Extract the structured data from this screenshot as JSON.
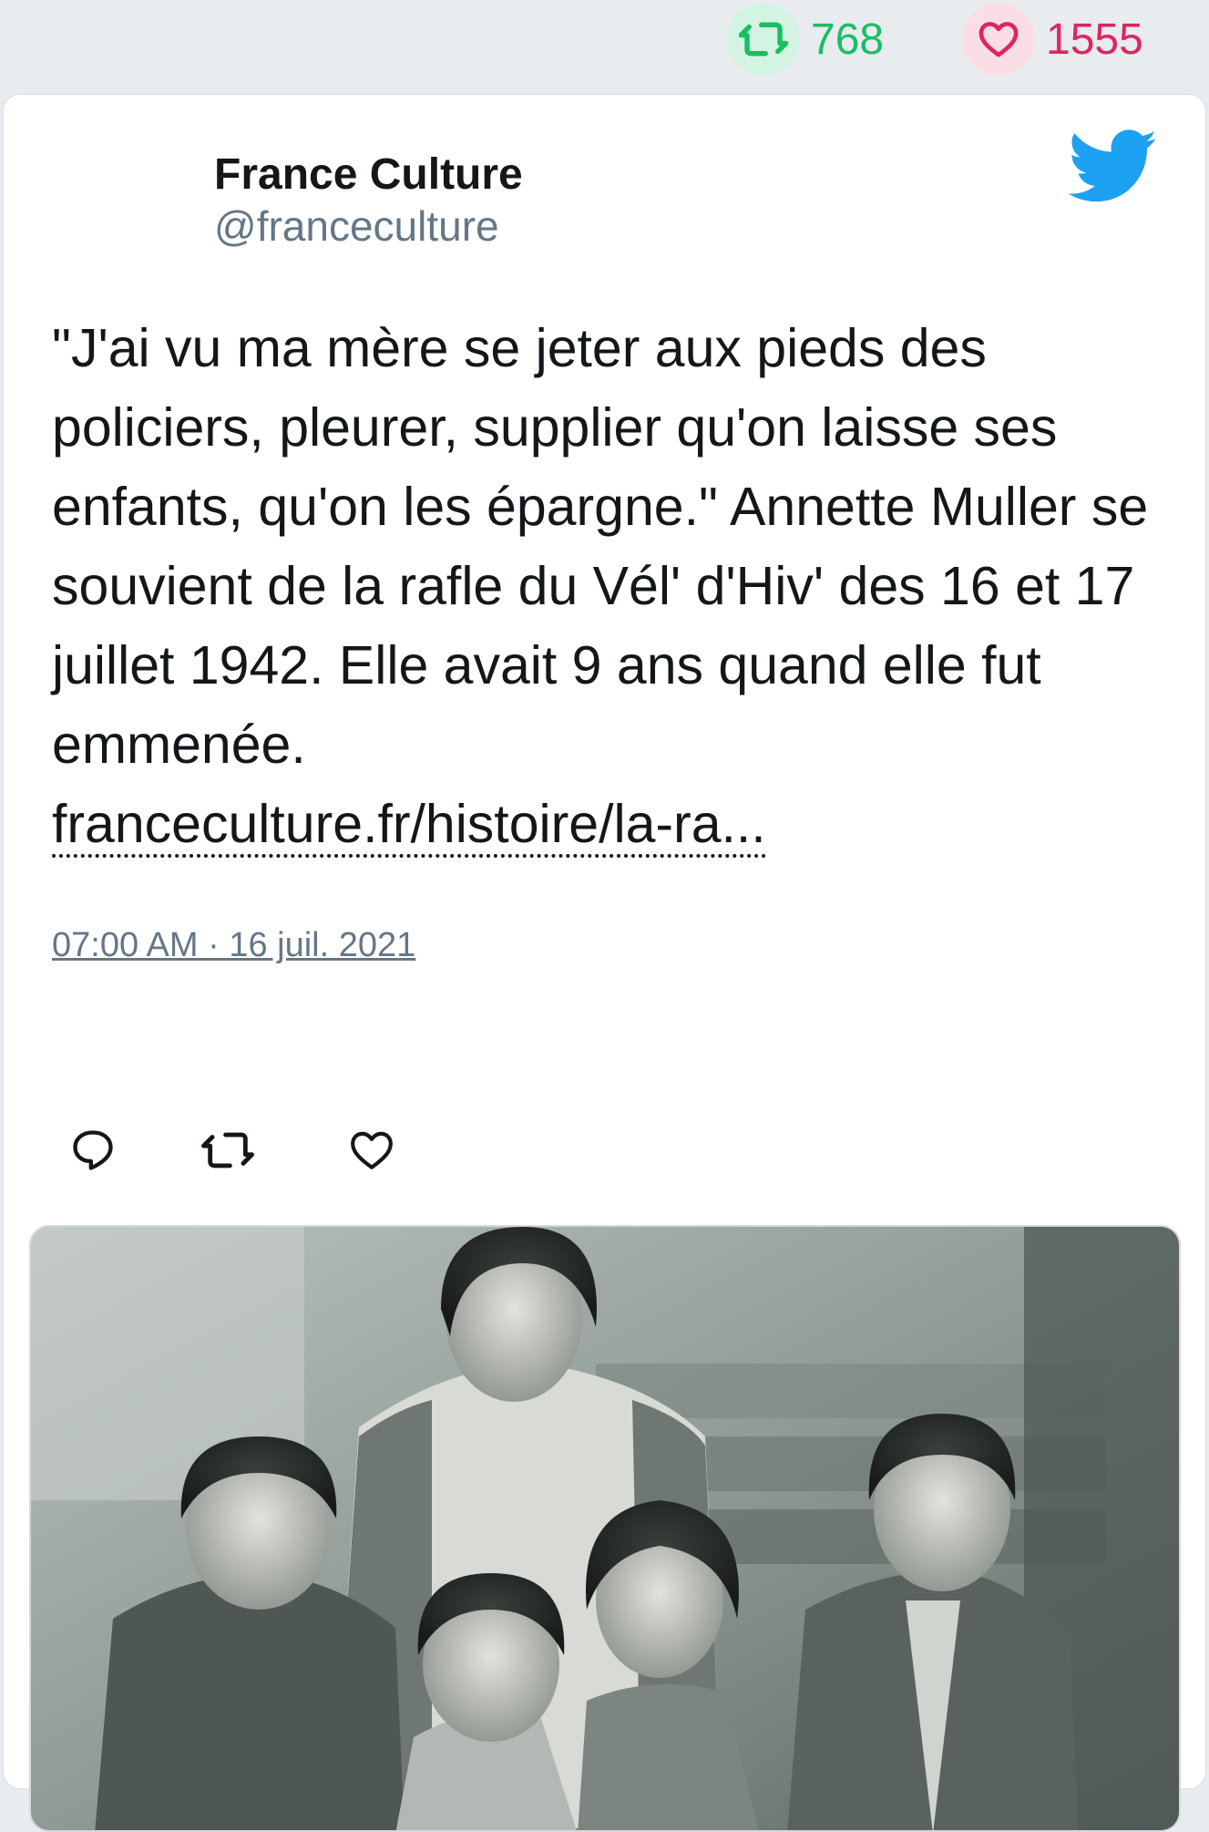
{
  "stats": {
    "retweet_count": "768",
    "like_count": "1555",
    "retweet_color": "#17bf63",
    "like_color": "#e0245e"
  },
  "author": {
    "name": "France Culture",
    "handle": "@franceculture"
  },
  "tweet": {
    "text": "\"J'ai vu ma mère se jeter aux pieds des policiers, pleurer, supplier qu'on laisse ses enfants, qu'on les épargne.\" Annette Muller se souvient de la rafle du Vél' d'Hiv' des 16 et 17 juillet 1942. Elle avait 9 ans quand elle fut emmenée.",
    "link": "franceculture.fr/histoire/la-ra...",
    "timestamp": "07:00 AM · 16 juil. 2021"
  },
  "icons": {
    "brand": "twitter-bird-icon",
    "reply": "reply-icon",
    "retweet": "retweet-icon",
    "like": "heart-icon"
  },
  "colors": {
    "brand": "#1da1f2",
    "text": "#14171a",
    "secondary": "#657786"
  },
  "media": {
    "description": "black-and-white family photograph"
  }
}
